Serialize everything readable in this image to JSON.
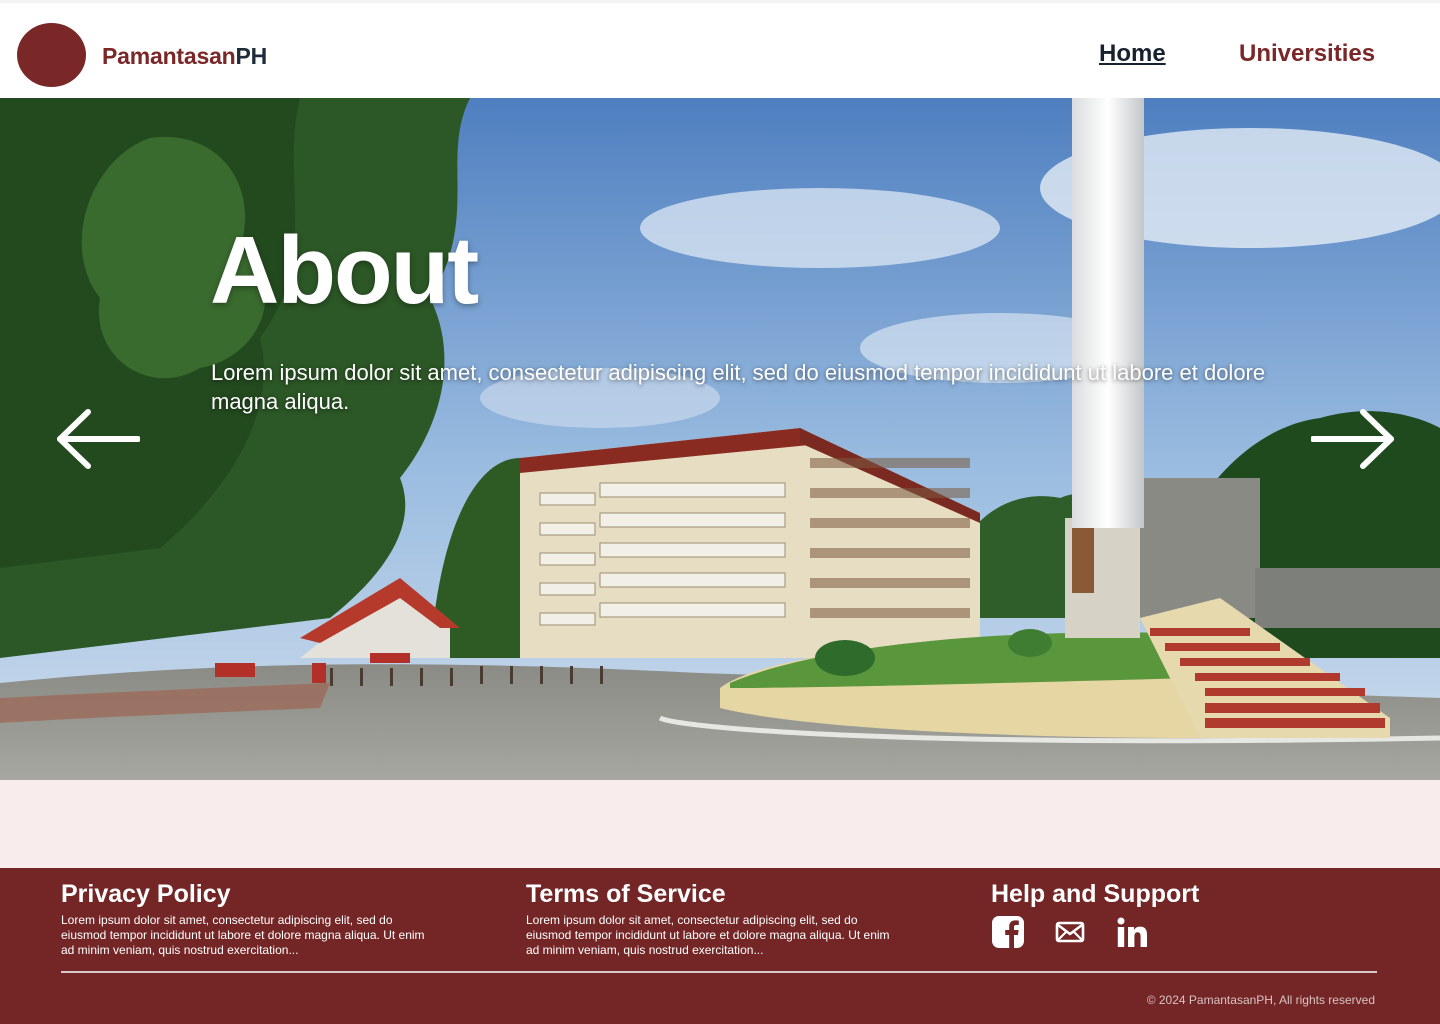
{
  "header": {
    "brand_part1": "Pamantasan",
    "brand_part2": "PH",
    "nav": {
      "home": "Home",
      "universities": "Universities"
    }
  },
  "hero": {
    "title": "About",
    "description": "Lorem ipsum dolor sit amet, consectetur adipiscing elit, sed do eiusmod tempor incididunt ut labore et dolore magna aliqua.",
    "prev_icon": "arrow-left-icon",
    "next_icon": "arrow-right-icon"
  },
  "footer": {
    "privacy": {
      "title": "Privacy Policy",
      "text": "Lorem ipsum dolor sit amet, consectetur adipiscing elit, sed do eiusmod tempor incididunt ut labore et dolore magna aliqua. Ut enim ad minim veniam, quis nostrud exercitation..."
    },
    "terms": {
      "title": "Terms of Service",
      "text": "Lorem ipsum dolor sit amet, consectetur adipiscing elit, sed do eiusmod tempor incididunt ut labore et dolore magna aliqua. Ut enim ad minim veniam, quis nostrud exercitation..."
    },
    "help": {
      "title": "Help and Support",
      "icons": [
        "facebook-icon",
        "mail-icon",
        "linkedin-icon"
      ]
    },
    "copyright": "© 2024 PamantasanPH, All rights reserved"
  },
  "colors": {
    "brand": "#7a2728",
    "footer_bg": "#742627",
    "band_bg": "#f8ecec",
    "nav_dark": "#16222e"
  }
}
